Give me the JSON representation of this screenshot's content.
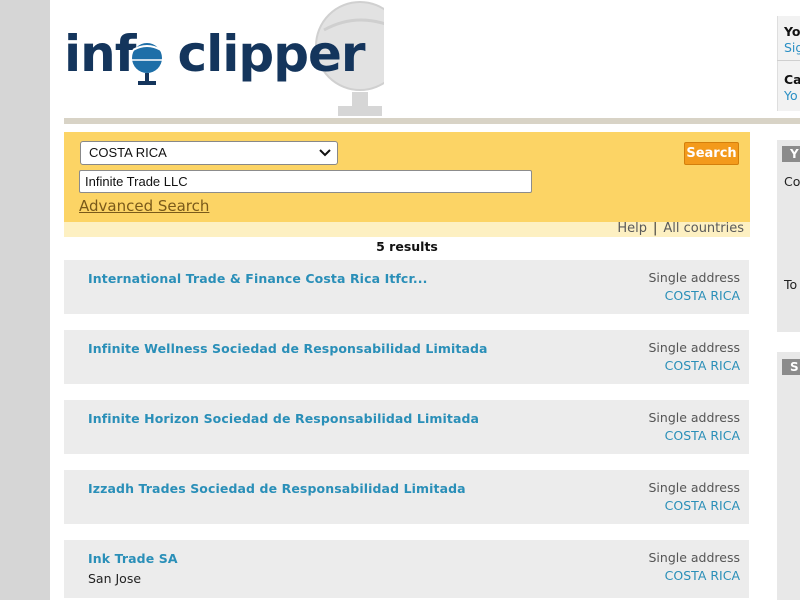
{
  "brand": {
    "part1": "inf",
    "part2": "clipper"
  },
  "account": {
    "line1_title": "Yo",
    "line1_link": "Sig",
    "line2_title": "Ca",
    "line2_link": "Yo"
  },
  "side": {
    "box1_head": "Y",
    "box1_text1": "Co",
    "box1_text2": "To",
    "box2_head": "S"
  },
  "search": {
    "country_selected": "COSTA RICA",
    "query_value": "Infinite Trade LLC",
    "button_label": "Search",
    "advanced_link": "Advanced Search",
    "help_link": "Help",
    "separator": "|",
    "all_countries_link": "All countries",
    "result_count": "5 results"
  },
  "results": [
    {
      "name": "International Trade & Finance Costa Rica Itfcr...",
      "address_type": "Single address",
      "country": "COSTA RICA",
      "city": ""
    },
    {
      "name": "Infinite Wellness Sociedad de Responsabilidad Limitada",
      "address_type": "Single address",
      "country": "COSTA RICA",
      "city": ""
    },
    {
      "name": "Infinite Horizon Sociedad de Responsabilidad Limitada",
      "address_type": "Single address",
      "country": "COSTA RICA",
      "city": ""
    },
    {
      "name": "Izzadh Trades Sociedad de Responsabilidad Limitada",
      "address_type": "Single address",
      "country": "COSTA RICA",
      "city": ""
    },
    {
      "name": "Ink Trade SA",
      "address_type": "Single address",
      "country": "COSTA RICA",
      "city": "San Jose"
    }
  ],
  "colors": {
    "search_panel": "#fcd465",
    "search_button": "#f39a1b",
    "result_link": "#2a8fb8",
    "logo_navy": "#14355c"
  }
}
